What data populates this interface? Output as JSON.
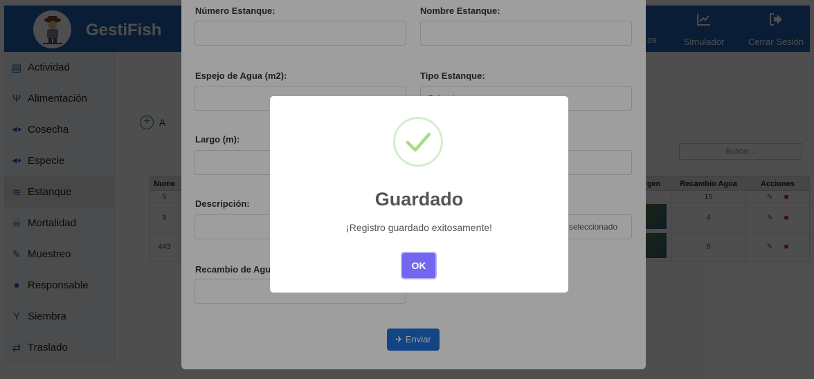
{
  "app": {
    "brand": "GestiFish",
    "nav": [
      {
        "label": "Simulador",
        "icon": "chart-line-icon",
        "glyph": "📈"
      },
      {
        "label": "Cerrar Sesión",
        "icon": "sign-out-icon",
        "glyph": "➜"
      }
    ],
    "nav_partial": "os"
  },
  "sidebar": {
    "items": [
      {
        "label": "Actividad",
        "icon": "clipboard-icon",
        "glyph": "▤"
      },
      {
        "label": "Alimentación",
        "icon": "utensils-icon",
        "glyph": "Ψ"
      },
      {
        "label": "Cosecha",
        "icon": "fish-icon",
        "glyph": "◀●"
      },
      {
        "label": "Especie",
        "icon": "fish-icon",
        "glyph": "◀●"
      },
      {
        "label": "Estanque",
        "icon": "water-icon",
        "glyph": "≋"
      },
      {
        "label": "Mortalidad",
        "icon": "skull-icon",
        "glyph": "☠"
      },
      {
        "label": "Muestreo",
        "icon": "syringe-icon",
        "glyph": "✎"
      },
      {
        "label": "Responsable",
        "icon": "user-icon",
        "glyph": "●"
      },
      {
        "label": "Siembra",
        "icon": "seedling-icon",
        "glyph": "Y"
      },
      {
        "label": "Traslado",
        "icon": "exchange-icon",
        "glyph": "⇄"
      }
    ],
    "active": "Estanque"
  },
  "main": {
    "add_partial": "A",
    "search_placeholder": "Buscar...",
    "columns": [
      "Nume",
      "gen",
      "Recambio Agua",
      "Acciones"
    ],
    "rows": [
      {
        "num": "5",
        "recambio": "15"
      },
      {
        "num": "9",
        "recambio": "4"
      },
      {
        "num": "443",
        "recambio": "6"
      }
    ]
  },
  "form": {
    "numero_label": "Número Estanque:",
    "nombre_label": "Nombre Estanque:",
    "espejo_label": "Espejo de Agua (m2):",
    "tipo_label": "Tipo Estanque:",
    "tipo_value": "Seleccione...",
    "largo_label": "Largo (m):",
    "descripcion_label": "Descripción:",
    "archivo_value": "seleccionado",
    "recambio_label": "Recambio de Agu",
    "submit_label": "Enviar"
  },
  "alert": {
    "title": "Guardado",
    "message": "¡Registro guardado exitosamente!",
    "ok_label": "OK",
    "success_color": "#a5dc86",
    "button_color": "#7367f0"
  }
}
